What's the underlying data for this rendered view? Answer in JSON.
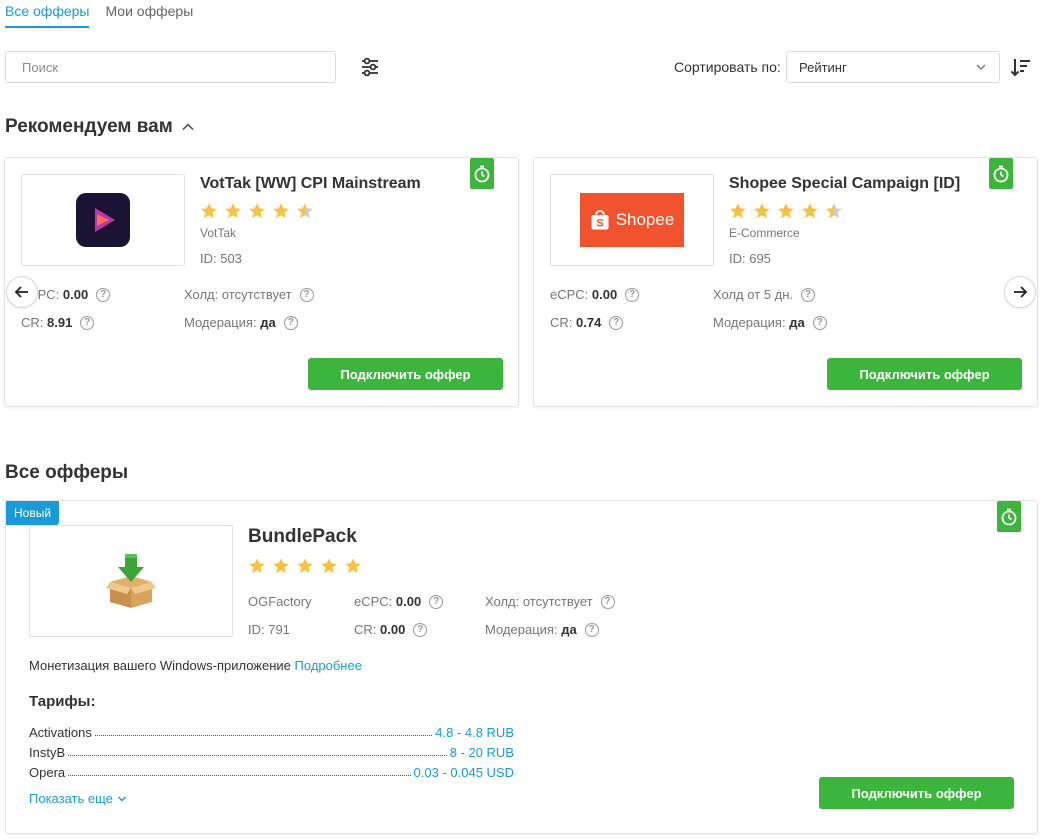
{
  "tabs": [
    {
      "label": "Все офферы",
      "active": true
    },
    {
      "label": "Мои офферы",
      "active": false
    }
  ],
  "toolbar": {
    "search_placeholder": "Поиск",
    "sort_label": "Сортировать по:",
    "sort_value": "Рейтинг"
  },
  "recommended": {
    "title": "Рекомендуем вам",
    "cards": [
      {
        "title": "VotTak [WW] CPI Mainstream",
        "rating": 4.5,
        "category": "VotTak",
        "id_label": "ID: 503",
        "ecpc_label": "eCPC:",
        "ecpc": "0.00",
        "cr_label": "CR:",
        "cr": "8.91",
        "hold": "Холд: отсутствует",
        "moderation_label": "Модерация:",
        "moderation": "да",
        "button": "Подключить оффер"
      },
      {
        "title": "Shopee Special Campaign [ID]",
        "rating": 4.5,
        "category": "E-Commerce",
        "id_label": "ID: 695",
        "logo_text": "Shopee",
        "ecpc_label": "eCPC:",
        "ecpc": "0.00",
        "cr_label": "CR:",
        "cr": "0.74",
        "hold": "Холд от 5 дн.",
        "moderation_label": "Модерация:",
        "moderation": "да",
        "button": "Подключить оффер"
      }
    ]
  },
  "all_offers": {
    "title": "Все офферы",
    "offer": {
      "badge": "Новый",
      "title": "BundlePack",
      "rating": 5,
      "category": "OGFactory",
      "id_label": "ID: 791",
      "ecpc_label": "eCPC:",
      "ecpc": "0.00",
      "cr_label": "CR:",
      "cr": "0.00",
      "hold": "Холд: отсутствует",
      "moderation_label": "Модерация:",
      "moderation": "да",
      "description": "Монетизация вашего Windows-приложение",
      "more_link": "Подробнее",
      "tariffs_title": "Тарифы:",
      "tariffs": [
        {
          "name": "Activations",
          "value": "4.8 - 4.8 RUB"
        },
        {
          "name": "InstyB",
          "value": "8 - 20 RUB"
        },
        {
          "name": "Opera",
          "value": "0.03 - 0.045 USD"
        }
      ],
      "show_more": "Показать еще",
      "button": "Подключить оффер"
    }
  },
  "colors": {
    "accent": "#1a9ad6",
    "green": "#3bb53b",
    "star": "#f5c342",
    "star_empty": "#cccccc"
  }
}
